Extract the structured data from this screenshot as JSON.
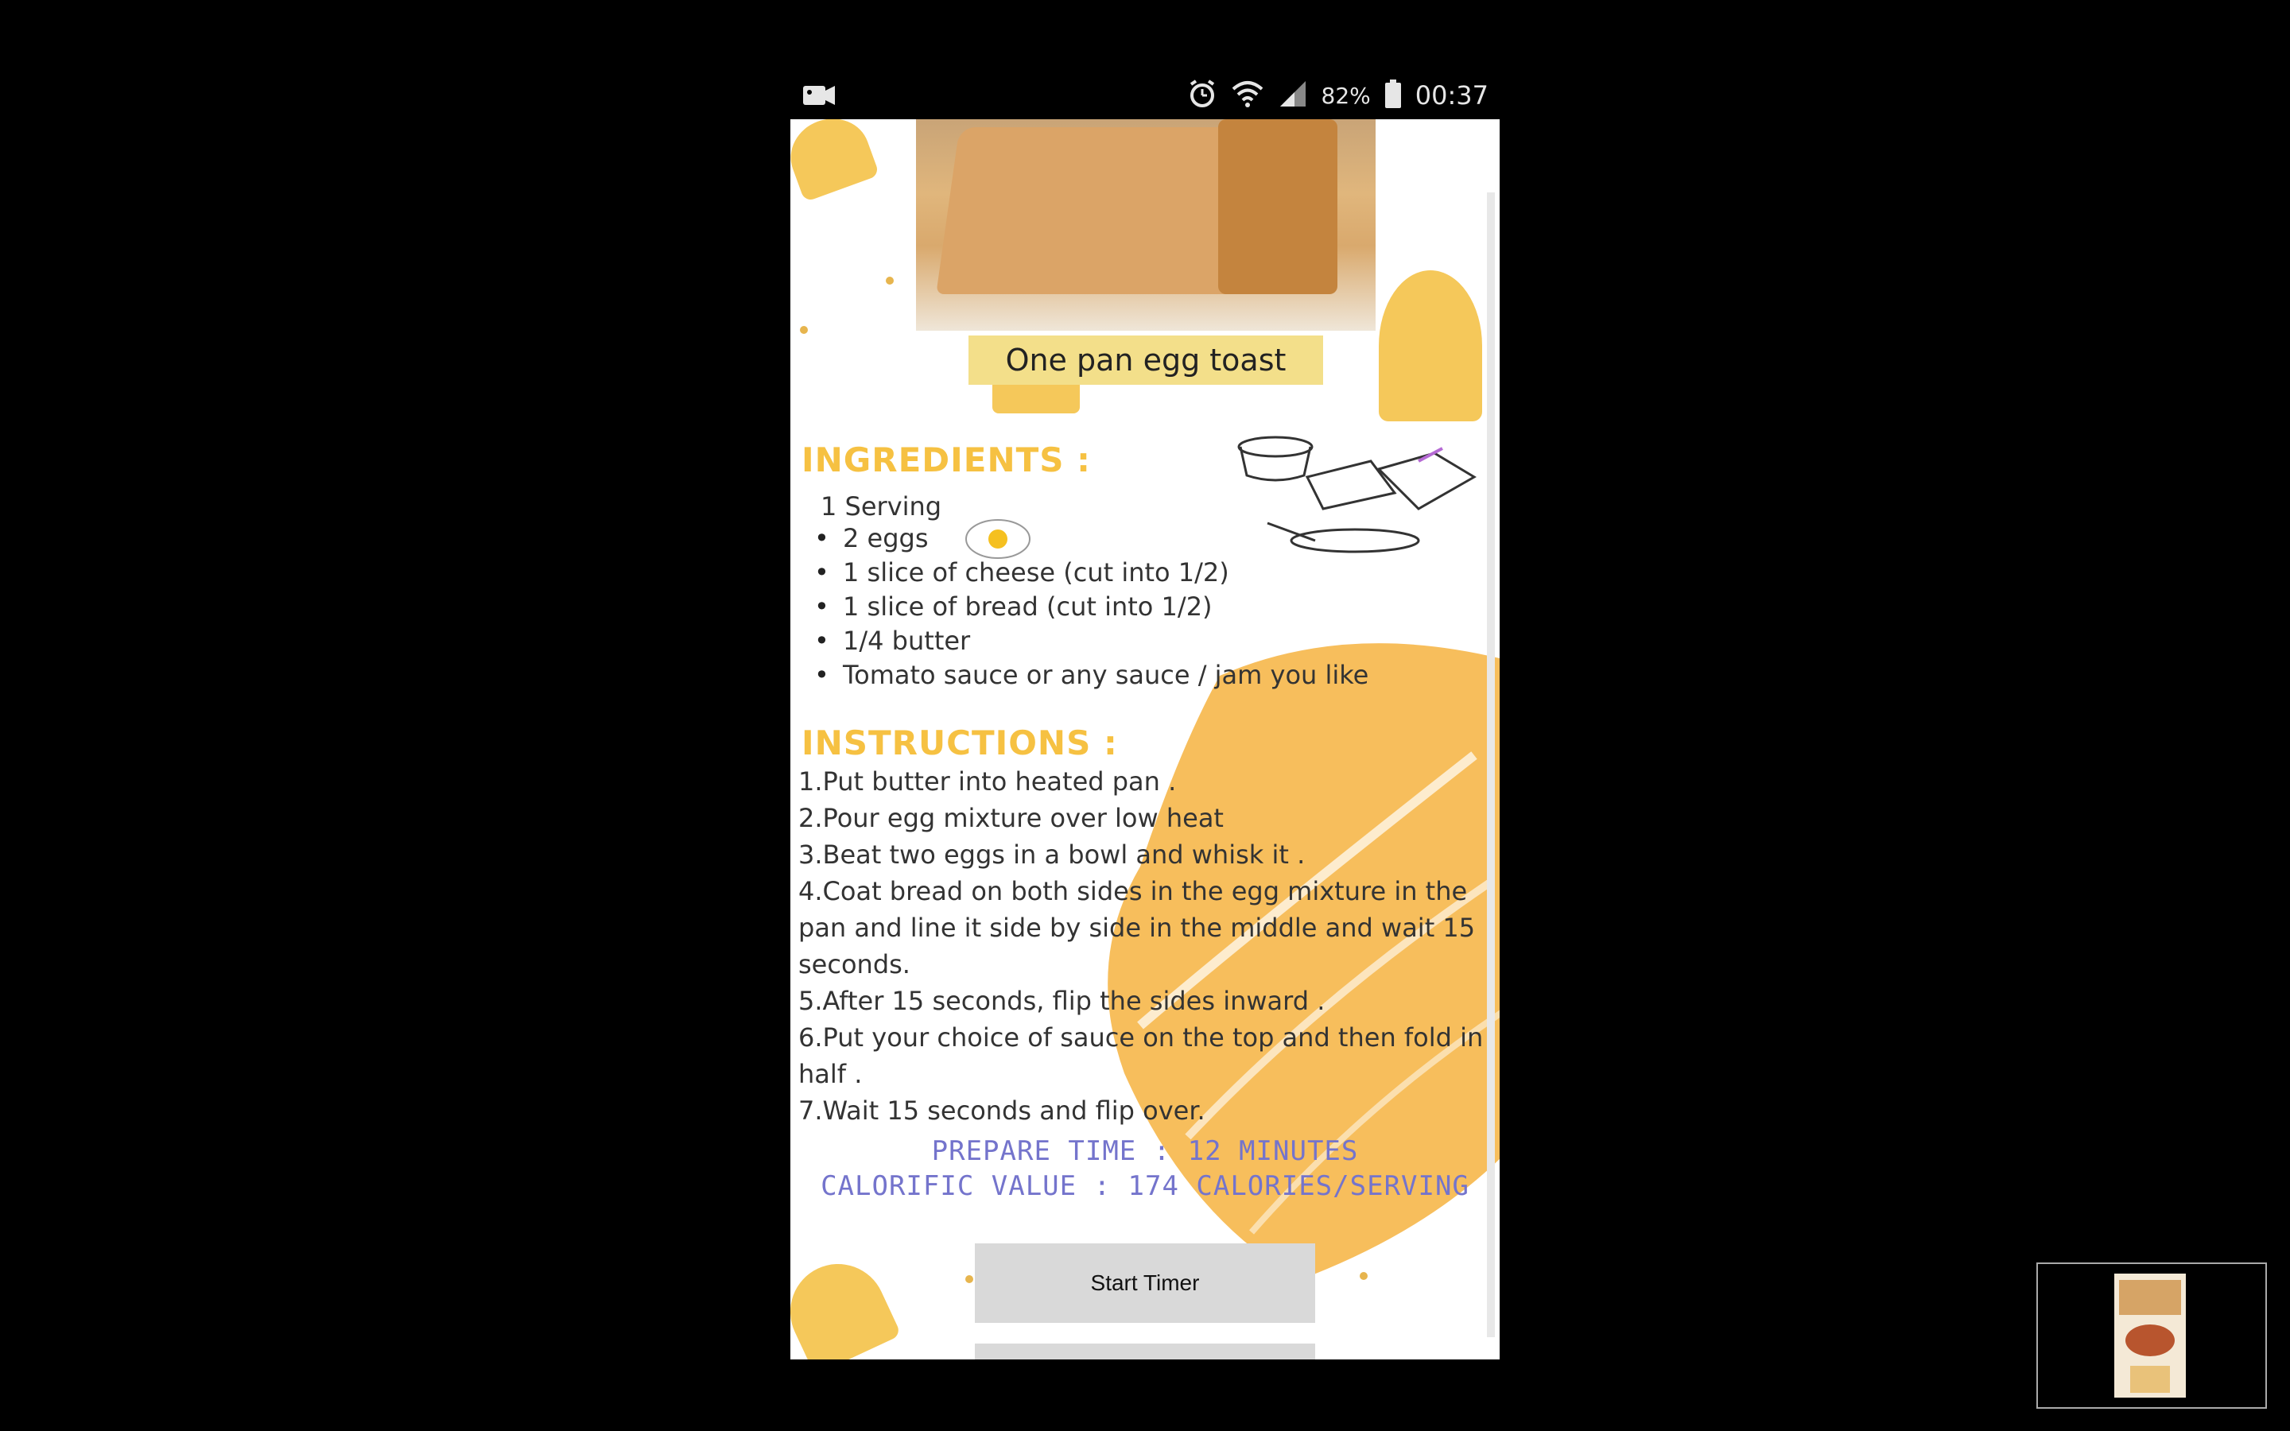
{
  "status_bar": {
    "left_icon": "video-camera-icon",
    "icons": [
      "alarm-icon",
      "wifi-icon",
      "signal-icon"
    ],
    "battery_percent": "82%",
    "time": "00:37"
  },
  "recipe": {
    "title": "One pan egg toast",
    "ingredients_heading": "INGREDIENTS :",
    "serving": "1 Serving",
    "ingredients": [
      "2 eggs",
      "1 slice of cheese (cut into 1/2)",
      "1 slice of bread (cut into 1/2)",
      "1/4 butter",
      "Tomato sauce or any sauce / jam you like"
    ],
    "instructions_heading": "INSTRUCTIONS :",
    "steps": [
      "1.Put butter into heated pan .",
      "2.Pour egg mixture over low heat",
      "3.Beat two eggs in a bowl and whisk it .",
      "4.Coat bread on both sides in the egg mixture in the pan and line it side by side in the middle and wait 15 seconds.",
      "5.After 15 seconds, flip the sides inward .",
      "6.Put your choice of sauce on the top and then fold in half .",
      "7.Wait 15 seconds and flip over."
    ],
    "prepare_time": "PREPARE TIME : 12 MINUTES",
    "calorific_value": "CALORIFIC VALUE : 174 CALORIES/SERVING",
    "start_timer_label": "Start Timer"
  },
  "colors": {
    "accent_yellow": "#f6c142",
    "meta_text": "#7474cc",
    "title_bg": "#f3df8a"
  }
}
